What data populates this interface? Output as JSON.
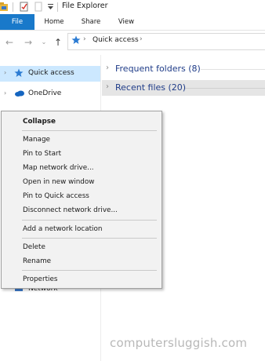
{
  "window": {
    "title": "File Explorer"
  },
  "ribbon": {
    "tabs": [
      "File",
      "Home",
      "Share",
      "View"
    ]
  },
  "address": {
    "path": "Quick access"
  },
  "navpane": {
    "items": [
      {
        "label": "Quick access",
        "icon": "star-icon"
      },
      {
        "label": "OneDrive",
        "icon": "cloud-icon"
      },
      {
        "label": "Network",
        "icon": "network-icon"
      }
    ]
  },
  "content": {
    "groups": [
      {
        "label": "Frequent folders (8)"
      },
      {
        "label": "Recent files (20)"
      }
    ]
  },
  "context_menu": {
    "items": [
      "Collapse",
      "Manage",
      "Pin to Start",
      "Map network drive...",
      "Open in new window",
      "Pin to Quick access",
      "Disconnect network drive...",
      "Add a network location",
      "Delete",
      "Rename",
      "Properties"
    ]
  },
  "watermark": "computersluggish.com",
  "colors": {
    "accent": "#1979ca",
    "selection": "#cce8ff",
    "group_text": "#1f3c88"
  }
}
